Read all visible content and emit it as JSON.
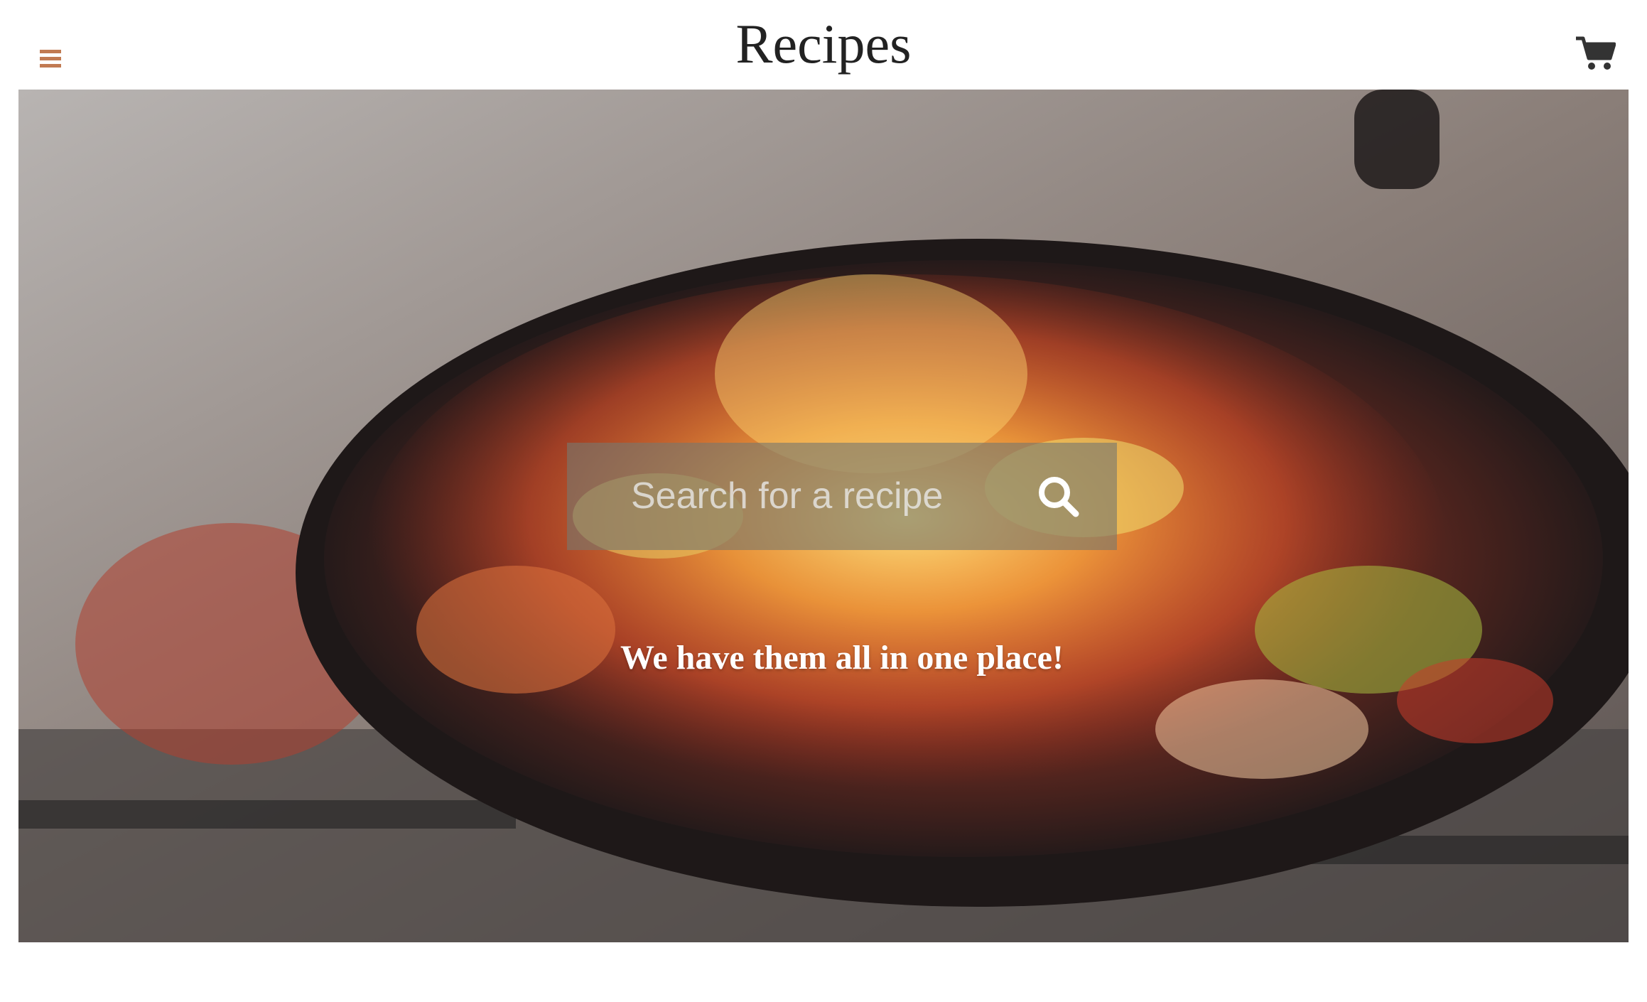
{
  "header": {
    "title": "Recipes",
    "menu_icon": "hamburger-menu-icon",
    "cart_icon": "shopping-cart-icon"
  },
  "hero": {
    "image": "cooking-pan-flames-photo",
    "search": {
      "placeholder": "Search for a recipe",
      "value": "",
      "icon": "search-icon"
    },
    "tagline": "We have them all in one place!"
  },
  "colors": {
    "accent": "#c17a52",
    "title_text": "#222222",
    "tagline_text": "#ffffff",
    "search_overlay": "#78786e"
  }
}
